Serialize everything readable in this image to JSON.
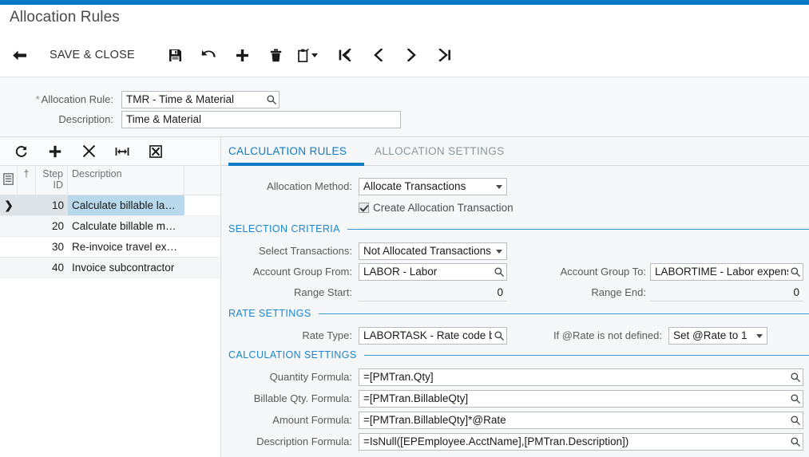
{
  "theme": {
    "accent": "#0078c8",
    "tab_active": "#0d7ac4",
    "section_blue": "#1a86d0",
    "row_selected": "#b8d9ec"
  },
  "page": {
    "title": "Allocation Rules"
  },
  "toolbar": {
    "back_icon": "arrow-left-icon",
    "save_close_label": "SAVE & CLOSE",
    "save_icon": "save-floppy-icon",
    "undo_icon": "undo-arrow-icon",
    "add_icon": "plus-icon",
    "delete_icon": "trash-icon",
    "clipboard_icon": "clipboard-icon",
    "clipboard_caret": "chevron-down-icon",
    "first_icon": "go-first-icon",
    "prev_icon": "go-previous-icon",
    "next_icon": "go-next-icon",
    "last_icon": "go-last-icon"
  },
  "summary": {
    "allocation_rule": {
      "required_marker": "*",
      "label": "Allocation Rule:",
      "value": "TMR - Time & Material",
      "lookup_icon": "magnifier-icon"
    },
    "description": {
      "label": "Description:",
      "value": "Time & Material"
    }
  },
  "grid": {
    "toolbar": {
      "refresh_icon": "refresh-icon",
      "add_row_icon": "plus-icon",
      "delete_row_icon": "close-x-icon",
      "fit_columns_icon": "fit-width-icon",
      "export_excel_icon": "export-excel-icon"
    },
    "columns": {
      "notes_icon": "notes-icon",
      "flag": "†",
      "step_id": "Step ID",
      "description": "Description"
    },
    "rows": [
      {
        "selected_marker": "❯",
        "step_id": "10",
        "description": "Calculate billable la…"
      },
      {
        "selected_marker": "",
        "step_id": "20",
        "description": "Calculate billable m…"
      },
      {
        "selected_marker": "",
        "step_id": "30",
        "description": "Re-invoice travel ex…"
      },
      {
        "selected_marker": "",
        "step_id": "40",
        "description": "Invoice subcontractor"
      }
    ]
  },
  "detail": {
    "tabs": [
      {
        "label": "CALCULATION RULES",
        "active": true
      },
      {
        "label": "ALLOCATION SETTINGS",
        "active": false
      }
    ],
    "allocation_method": {
      "label": "Allocation Method:",
      "value": "Allocate Transactions",
      "dropdown_icon": "chevron-down-icon"
    },
    "create_allocation_transaction": {
      "label": "Create Allocation Transaction",
      "checked": true
    },
    "selection_criteria": {
      "section_title": "SELECTION CRITERIA",
      "select_transactions": {
        "label": "Select Transactions:",
        "value": "Not Allocated Transactions",
        "dropdown_icon": "chevron-down-icon"
      },
      "account_group_from": {
        "label": "Account Group From:",
        "value": "LABOR - Labor",
        "lookup_icon": "magnifier-icon"
      },
      "account_group_to": {
        "label": "Account Group To:",
        "value": "LABORTIME - Labor expens",
        "lookup_icon": "magnifier-icon"
      },
      "range_start": {
        "label": "Range Start:",
        "value": "0"
      },
      "range_end": {
        "label": "Range End:",
        "value": "0"
      }
    },
    "rate_settings": {
      "section_title": "RATE SETTINGS",
      "rate_type": {
        "label": "Rate Type:",
        "value": "LABORTASK - Rate code b",
        "lookup_icon": "magnifier-icon"
      },
      "rate_not_defined": {
        "label": "If @Rate is not defined:",
        "value": "Set @Rate to 1",
        "dropdown_icon": "chevron-down-icon"
      }
    },
    "calculation_settings": {
      "section_title": "CALCULATION SETTINGS",
      "formulas": [
        {
          "label": "Quantity Formula:",
          "value": "=[PMTran.Qty]",
          "lookup_icon": "magnifier-icon"
        },
        {
          "label": "Billable Qty. Formula:",
          "value": "=[PMTran.BillableQty]",
          "lookup_icon": "magnifier-icon"
        },
        {
          "label": "Amount Formula:",
          "value": "=[PMTran.BillableQty]*@Rate",
          "lookup_icon": "magnifier-icon"
        },
        {
          "label": "Description Formula:",
          "value": "=IsNull([EPEmployee.AcctName],[PMTran.Description])",
          "lookup_icon": "magnifier-icon"
        }
      ]
    }
  }
}
